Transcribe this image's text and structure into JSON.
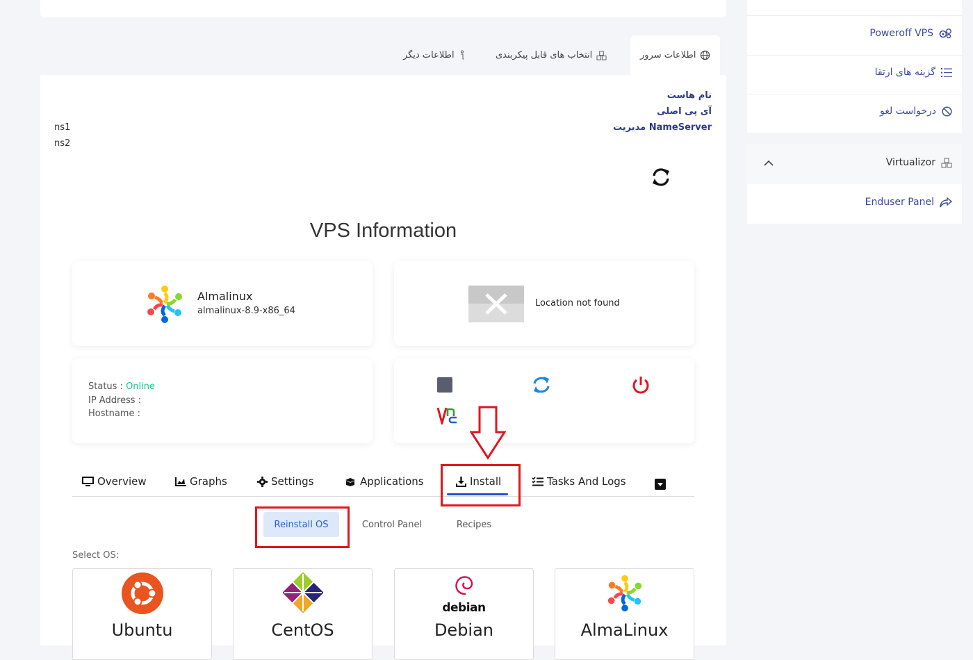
{
  "tabs": [
    {
      "label": "اطلاعات سرور",
      "icon": "globe-icon",
      "active": true
    },
    {
      "label": "انتخاب های قابل پیکربندی",
      "icon": "cubes-icon",
      "active": false
    },
    {
      "label": "اطلاعات دیگر",
      "icon": "info-icon",
      "active": false
    }
  ],
  "server_info": {
    "hostname_label": "نام هاست",
    "ip_label": "آی پی اصلی",
    "nameserver_label": "NameServer مدیریت",
    "ns1": "ns1",
    "ns2": "ns2"
  },
  "vps": {
    "title": "VPS Information",
    "os_name": "Almalinux",
    "os_version": "almalinux-8.9-x86_64",
    "location": "Location not found",
    "status_label": "Status :",
    "status_value": "Online",
    "ip_label": "IP Address :",
    "hostname_label": "Hostname :"
  },
  "colors": {
    "online": "#1ec48a",
    "power": "#e0161f",
    "restart": "#1e88e5",
    "stop": "#5a5d6e",
    "highlight": "#e0161f",
    "accent": "#2a4cd7"
  },
  "nav": [
    {
      "label": "Overview",
      "icon": "monitor-icon"
    },
    {
      "label": "Graphs",
      "icon": "chart-icon"
    },
    {
      "label": "Settings",
      "icon": "gear-icon"
    },
    {
      "label": "Applications",
      "icon": "box-icon"
    },
    {
      "label": "Install",
      "icon": "download-icon",
      "active": true
    },
    {
      "label": "Tasks And Logs",
      "icon": "tasks-icon"
    }
  ],
  "install": {
    "subtabs": [
      "Reinstall OS",
      "Control Panel",
      "Recipes"
    ],
    "select_label": "Select OS:",
    "os_options": [
      "Ubuntu",
      "CentOS",
      "Debian",
      "AlmaLinux"
    ],
    "debian_logo_text": "debian"
  },
  "sidebar": {
    "items": [
      {
        "label": "Poweroff VPS",
        "icon": "cogs-icon"
      },
      {
        "label": "گزینه های ارتقا",
        "icon": "list-icon"
      },
      {
        "label": "درخواست لغو",
        "icon": "ban-icon"
      }
    ],
    "panel_title": "Virtualizor",
    "panel_item": "Enduser Panel"
  }
}
